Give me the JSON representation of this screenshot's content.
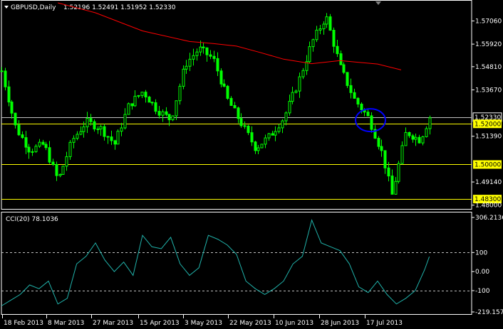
{
  "header": {
    "symbol": "GBPUSD,Daily",
    "ohlc": "1.52196 1.52491 1.51952 1.52330"
  },
  "chart_data": [
    {
      "type": "candlestick",
      "title": "GBPUSD,Daily 1.52196 1.52491 1.51952 1.52330",
      "ylim": [
        1.4785,
        1.5802
      ],
      "y_tick_labels": [
        "1.57060",
        "1.55920",
        "1.54810",
        "1.53670",
        "1.52330",
        "1.52000",
        "1.51390",
        "1.50000",
        "1.49140",
        "1.48300",
        "1.48000"
      ],
      "x_tick_labels": [
        "18 Feb 2013",
        "8 Mar 2013",
        "27 Mar 2013",
        "15 Apr 2013",
        "3 May 2013",
        "22 May 2013",
        "10 Jun 2013",
        "28 Jun 2013",
        "17 Jul 2013"
      ],
      "colors": {
        "up": "#00ff00",
        "down": "#00ff00",
        "ma": "#ff0000",
        "hline": "#ffff00",
        "current": "#ffffff",
        "marker": "#0000ff"
      },
      "horizontal_lines": [
        {
          "value": 1.52,
          "label": "1.52000",
          "color": "#ffff00"
        },
        {
          "value": 1.5,
          "label": "1.50000",
          "color": "#ffff00"
        },
        {
          "value": 1.483,
          "label": "1.48300",
          "color": "#ffff00"
        }
      ],
      "current_price": {
        "value": 1.5233,
        "label": "1.52330"
      },
      "ellipse_marker": {
        "date": "17 Jul 2013",
        "value": 1.5218
      },
      "moving_average": {
        "x_fraction": [
          0.12,
          0.2,
          0.3,
          0.4,
          0.45,
          0.5,
          0.55,
          0.6,
          0.66,
          0.72,
          0.8,
          0.85
        ],
        "values": [
          1.5795,
          1.5746,
          1.5657,
          1.5605,
          1.5595,
          1.5582,
          1.5551,
          1.5518,
          1.5496,
          1.5511,
          1.5494,
          1.5465
        ]
      },
      "ohlc": {
        "close_path": [
          {
            "x": 0.0,
            "close": 1.546
          },
          {
            "x": 0.03,
            "close": 1.518
          },
          {
            "x": 0.06,
            "close": 1.507
          },
          {
            "x": 0.09,
            "close": 1.51
          },
          {
            "x": 0.12,
            "close": 1.492
          },
          {
            "x": 0.15,
            "close": 1.512
          },
          {
            "x": 0.18,
            "close": 1.521
          },
          {
            "x": 0.21,
            "close": 1.518
          },
          {
            "x": 0.24,
            "close": 1.51
          },
          {
            "x": 0.27,
            "close": 1.529
          },
          {
            "x": 0.3,
            "close": 1.536
          },
          {
            "x": 0.33,
            "close": 1.527
          },
          {
            "x": 0.36,
            "close": 1.522
          },
          {
            "x": 0.39,
            "close": 1.549
          },
          {
            "x": 0.42,
            "close": 1.557
          },
          {
            "x": 0.45,
            "close": 1.552
          },
          {
            "x": 0.48,
            "close": 1.532
          },
          {
            "x": 0.51,
            "close": 1.52
          },
          {
            "x": 0.54,
            "close": 1.508
          },
          {
            "x": 0.57,
            "close": 1.514
          },
          {
            "x": 0.6,
            "close": 1.523
          },
          {
            "x": 0.63,
            "close": 1.54
          },
          {
            "x": 0.66,
            "close": 1.56
          },
          {
            "x": 0.69,
            "close": 1.573
          },
          {
            "x": 0.72,
            "close": 1.548
          },
          {
            "x": 0.75,
            "close": 1.532
          },
          {
            "x": 0.78,
            "close": 1.523
          },
          {
            "x": 0.81,
            "close": 1.505
          },
          {
            "x": 0.83,
            "close": 1.485
          },
          {
            "x": 0.86,
            "close": 1.516
          },
          {
            "x": 0.89,
            "close": 1.512
          },
          {
            "x": 0.91,
            "close": 1.5233
          }
        ]
      }
    },
    {
      "type": "line",
      "title": "CCI(20) 78.1036",
      "ylim": [
        -219.1575,
        306.2136
      ],
      "y_tick_labels": [
        "306.2136",
        "100",
        "0.00",
        "-100",
        "-219.1575"
      ],
      "reference_lines": [
        100,
        -100
      ],
      "colors": {
        "line": "#20b2aa",
        "reference": "#c0c0c0"
      },
      "series": [
        {
          "x_fraction": [
            0.0,
            0.02,
            0.04,
            0.06,
            0.08,
            0.1,
            0.12,
            0.14,
            0.16,
            0.18,
            0.2,
            0.22,
            0.24,
            0.26,
            0.28,
            0.3,
            0.32,
            0.34,
            0.36,
            0.38,
            0.4,
            0.42,
            0.44,
            0.46,
            0.48,
            0.5,
            0.52,
            0.54,
            0.56,
            0.58,
            0.6,
            0.62,
            0.64,
            0.66,
            0.68,
            0.7,
            0.72,
            0.74,
            0.76,
            0.78,
            0.8,
            0.82,
            0.84,
            0.86,
            0.88,
            0.9,
            0.91
          ],
          "values": [
            -180,
            -150,
            -120,
            -70,
            -90,
            -50,
            -170,
            -140,
            40,
            80,
            150,
            60,
            0,
            50,
            -20,
            190,
            130,
            120,
            180,
            40,
            -20,
            20,
            190,
            170,
            140,
            90,
            -50,
            -90,
            -120,
            -90,
            -50,
            40,
            80,
            270,
            150,
            130,
            110,
            40,
            -80,
            -110,
            -50,
            -120,
            -170,
            -140,
            -100,
            10,
            78
          ]
        }
      ]
    }
  ]
}
